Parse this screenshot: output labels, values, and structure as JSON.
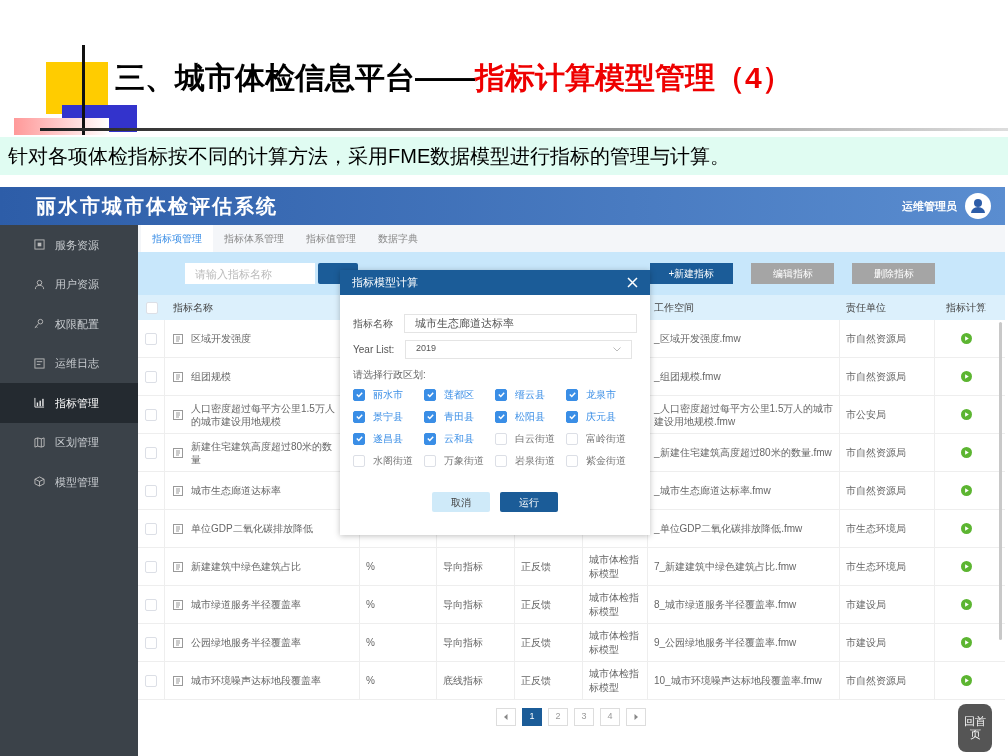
{
  "slide": {
    "title": "三、城市体检信息平台——",
    "title_highlight": "指标计算模型管理（4）",
    "subtitle": "针对各项体检指标按不同的计算方法，采用FME数据模型进行指标的管理与计算。",
    "home_button": "回首页"
  },
  "app": {
    "title": "丽水市城市体检评估系统",
    "user": "运维管理员"
  },
  "sidebar": {
    "items": [
      {
        "label": "服务资源",
        "selected": false
      },
      {
        "label": "用户资源",
        "selected": false
      },
      {
        "label": "权限配置",
        "selected": false
      },
      {
        "label": "运维日志",
        "selected": false
      },
      {
        "label": "指标管理",
        "selected": true
      },
      {
        "label": "区划管理",
        "selected": false
      },
      {
        "label": "模型管理",
        "selected": false
      }
    ]
  },
  "tabs": [
    {
      "label": "指标项管理",
      "selected": true
    },
    {
      "label": "指标体系管理",
      "selected": false
    },
    {
      "label": "指标值管理",
      "selected": false
    },
    {
      "label": "数据字典",
      "selected": false
    }
  ],
  "toolbar": {
    "search": {
      "placeholder": "请输入指标名称"
    },
    "buttons": [
      {
        "label": "+新建指标",
        "kind": "primary"
      },
      {
        "label": "编辑指标",
        "kind": "secondary"
      },
      {
        "label": "删除指标",
        "kind": "secondary"
      }
    ]
  },
  "table": {
    "header_checked": false,
    "columns": [
      "指标名称",
      "工作空间",
      "责任单位",
      "指标计算"
    ],
    "rows": [
      {
        "checked": false,
        "name": "区域开发强度",
        "workspace": "_区域开发强度.fmw",
        "department": "市自然资源局"
      },
      {
        "checked": false,
        "name": "组团规模",
        "workspace": "_组团规模.fmw",
        "department": "市自然资源局"
      },
      {
        "checked": false,
        "name": "人口密度超过每平方公里1.5万人的城市建设用地规模",
        "workspace": "_人口密度超过每平方公里1.5万人的城市建设用地规模.fmw",
        "department": "市公安局"
      },
      {
        "checked": false,
        "name": "新建住宅建筑高度超过80米的数量",
        "workspace": "_新建住宅建筑高度超过80米的数量.fmw",
        "department": "市自然资源局"
      },
      {
        "checked": false,
        "name": "城市生态廊道达标率",
        "workspace": "_城市生态廊道达标率.fmw",
        "department": "市自然资源局"
      },
      {
        "checked": false,
        "name": "单位GDP二氧化碳排放降低",
        "workspace": "_单位GDP二氧化碳排放降低.fmw",
        "department": "市生态环境局"
      },
      {
        "checked": false,
        "name": "新建建筑中绿色建筑占比",
        "unit": "%",
        "type": "导向指标",
        "feedback": "正反馈",
        "model": "城市体检指标模型",
        "workspace": "7_新建建筑中绿色建筑占比.fmw",
        "department": "市生态环境局"
      },
      {
        "checked": false,
        "name": "城市绿道服务半径覆盖率",
        "unit": "%",
        "type": "导向指标",
        "feedback": "正反馈",
        "model": "城市体检指标模型",
        "workspace": "8_城市绿道服务半径覆盖率.fmw",
        "department": "市建设局"
      },
      {
        "checked": false,
        "name": "公园绿地服务半径覆盖率",
        "unit": "%",
        "type": "导向指标",
        "feedback": "正反馈",
        "model": "城市体检指标模型",
        "workspace": "9_公园绿地服务半径覆盖率.fmw",
        "department": "市建设局"
      },
      {
        "checked": false,
        "name": "城市环境噪声达标地段覆盖率",
        "unit": "%",
        "type": "底线指标",
        "feedback": "正反馈",
        "model": "城市体检指标模型",
        "workspace": "10_城市环境噪声达标地段覆盖率.fmw",
        "department": "市自然资源局"
      }
    ]
  },
  "pagination": {
    "pages": [
      {
        "label": "1",
        "selected": true
      },
      {
        "label": "2",
        "selected": false
      },
      {
        "label": "3",
        "selected": false
      },
      {
        "label": "4",
        "selected": false
      }
    ]
  },
  "dialog": {
    "title": "指标模型计算",
    "fields": [
      {
        "label": "指标名称",
        "value": "城市生态廊道达标率",
        "kind": "text"
      },
      {
        "label": "Year List:",
        "value": "2019",
        "kind": "select"
      }
    ],
    "region_label": "请选择行政区划:",
    "regions": [
      {
        "label": "丽水市",
        "checked": true
      },
      {
        "label": "莲都区",
        "checked": true
      },
      {
        "label": "缙云县",
        "checked": true
      },
      {
        "label": "龙泉市",
        "checked": true
      },
      {
        "label": "景宁县",
        "checked": true
      },
      {
        "label": "青田县",
        "checked": true
      },
      {
        "label": "松阳县",
        "checked": true
      },
      {
        "label": "庆元县",
        "checked": true
      },
      {
        "label": "遂昌县",
        "checked": true
      },
      {
        "label": "云和县",
        "checked": true
      },
      {
        "label": "白云街道",
        "checked": false
      },
      {
        "label": "富岭街道",
        "checked": false
      },
      {
        "label": "水阁街道",
        "checked": false
      },
      {
        "label": "万象街道",
        "checked": false
      },
      {
        "label": "岩泉街道",
        "checked": false
      },
      {
        "label": "紫金街道",
        "checked": false
      }
    ],
    "buttons": [
      {
        "label": "取消",
        "kind": "secondary"
      },
      {
        "label": "运行",
        "kind": "primary"
      }
    ]
  }
}
